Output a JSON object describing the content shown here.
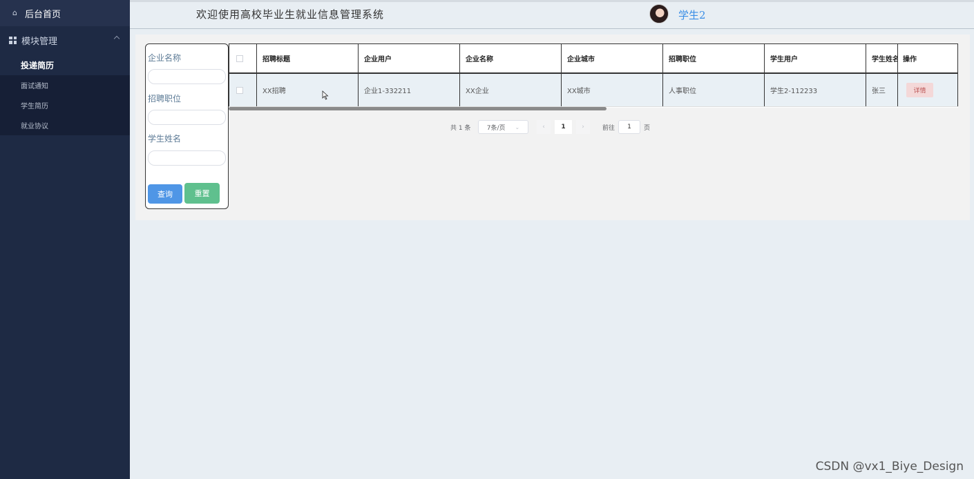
{
  "sidebar": {
    "home_label": "后台首页",
    "group_label": "模块管理",
    "items": [
      {
        "label": "投递简历",
        "active": true
      },
      {
        "label": "面试通知",
        "active": false
      },
      {
        "label": "学生简历",
        "active": false
      },
      {
        "label": "就业协议",
        "active": false
      }
    ]
  },
  "header": {
    "title": "欢迎使用高校毕业生就业信息管理系统",
    "user_name": "学生2"
  },
  "search": {
    "company_name_label": "企业名称",
    "company_name_value": "",
    "position_label": "招聘职位",
    "position_value": "",
    "student_name_label": "学生姓名",
    "student_name_value": "",
    "query_button": "查询",
    "reset_button": "重置"
  },
  "table": {
    "columns": [
      "招聘标题",
      "企业用户",
      "企业名称",
      "企业城市",
      "招聘职位",
      "学生用户",
      "学生姓名",
      "操作"
    ],
    "rows": [
      {
        "title": "XX招聘",
        "company_user": "企业1-332211",
        "company_name": "XX企业",
        "company_city": "XX城市",
        "position": "人事职位",
        "student_user": "学生2-112233",
        "student_name": "张三",
        "action": "详情"
      }
    ]
  },
  "pagination": {
    "total": "共 1 条",
    "page_size": "7条/页",
    "current_page": "1",
    "goto_label": "前往",
    "goto_value": "1",
    "page_suffix": "页"
  },
  "watermark": "CSDN @vx1_Biye_Design",
  "colors": {
    "sidebar_bg": "#1e2a44",
    "accent": "#3a8ee6",
    "query_button": "#4f96e6",
    "reset_button": "#5fc08e",
    "detail_button": "#f4d8d8"
  }
}
